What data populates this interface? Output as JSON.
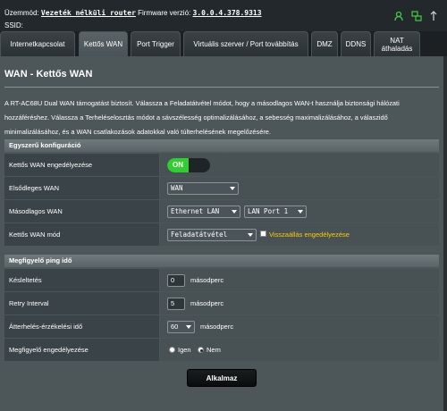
{
  "topbar": {
    "mode_label": "Üzemmód:",
    "mode_value": "Vezeték nélküli router",
    "firmware_label": "Firmware verzió:",
    "firmware_value": "3.0.0.4.378.9313",
    "ssid_label": "SSID:"
  },
  "tabs": [
    {
      "label": "Internetkapcsolat"
    },
    {
      "label": "Kettős WAN"
    },
    {
      "label": "Port Trigger"
    },
    {
      "label": "Virtuális szerver / Port továbbítás"
    },
    {
      "label": "DMZ"
    },
    {
      "label": "DDNS"
    },
    {
      "label": "NAT áthaladás"
    }
  ],
  "active_tab": "Kettős WAN",
  "page": {
    "title": "WAN - Kettős WAN",
    "description": "A RT-AC68U Dual WAN támogatást biztosít. Válassza a Feladatátvétel módot, hogy a másodlagos WAN-t használja biztonsági hálózati hozzáféréshez. Válassza a Terheléselosztás módot a sávszélesség optimalizálásához, a sebesség maximalizálásához, a válaszidő minimalizálásához, és a WAN csatlakozások adatokkal való túlterhelésének megelőzésére."
  },
  "basic": {
    "header": "Egyszerű konfiguráció",
    "enable_label": "Kettős WAN engedélyezése",
    "enable_state": "ON",
    "primary_label": "Elsődleges WAN",
    "primary_value": "WAN",
    "secondary_label": "Másodlagos WAN",
    "secondary_value": "Ethernet LAN",
    "secondary_port": "LAN Port 1",
    "mode_label": "Kettős WAN mód",
    "mode_value": "Feladatátvétel",
    "fallback_label": "Visszaállás engedélyezése"
  },
  "ping": {
    "header": "Megfigyelő ping idő",
    "delay_label": "Késleltetés",
    "delay_value": "0",
    "delay_unit": "másodperc",
    "retry_label": "Retry Interval",
    "retry_value": "5",
    "retry_unit": "másodperc",
    "detect_label": "Átterhelés-érzékelési idő",
    "detect_value": "60",
    "detect_unit": "másodperc",
    "monitor_label": "Megfigyelő engedélyezése",
    "opt_yes": "Igen",
    "opt_no": "Nem"
  },
  "apply_label": "Alkalmaz",
  "colors": {
    "toggle_on": "#33cc33",
    "warning": "#ffcc00",
    "accent_icon": "#44cc44"
  },
  "icons": [
    "user-icon",
    "network-icon",
    "usb-icon"
  ]
}
